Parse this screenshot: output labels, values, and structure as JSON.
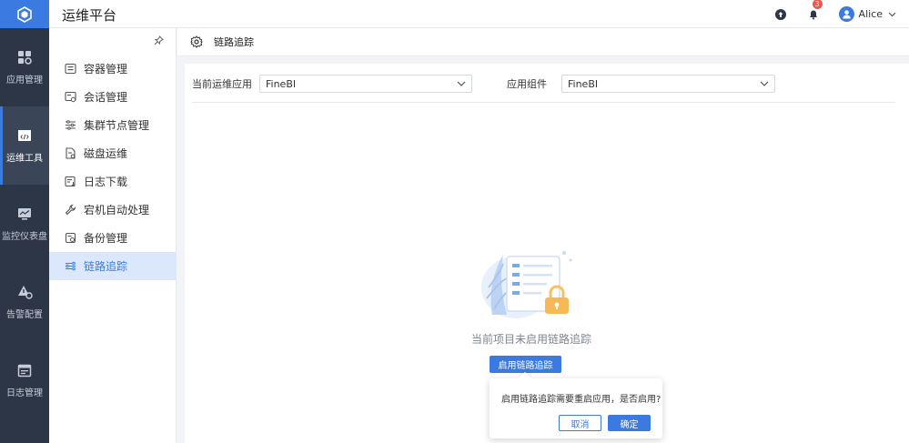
{
  "header": {
    "app_title": "运维平台",
    "notification_count": "3",
    "user_name": "Alice"
  },
  "leftnav": [
    {
      "label": "应用管理",
      "icon": "apps-grid-icon",
      "active": false
    },
    {
      "label": "运维工具",
      "icon": "code-window-icon",
      "active": true
    },
    {
      "label": "监控仪表盘",
      "icon": "monitor-icon",
      "active": false
    },
    {
      "label": "告警配置",
      "icon": "alert-settings-icon",
      "active": false
    },
    {
      "label": "日志管理",
      "icon": "calendar-log-icon",
      "active": false
    }
  ],
  "submenu": [
    {
      "label": "容器管理",
      "icon": "container-icon"
    },
    {
      "label": "会话管理",
      "icon": "session-icon"
    },
    {
      "label": "集群节点管理",
      "icon": "sliders-icon"
    },
    {
      "label": "磁盘运维",
      "icon": "disk-file-icon"
    },
    {
      "label": "日志下载",
      "icon": "log-download-icon"
    },
    {
      "label": "宕机自动处理",
      "icon": "wrench-icon"
    },
    {
      "label": "备份管理",
      "icon": "backup-icon"
    },
    {
      "label": "链路追踪",
      "icon": "trace-icon",
      "active": true
    }
  ],
  "page": {
    "title": "链路追踪"
  },
  "filters": {
    "app_label": "当前运维应用",
    "app_value": "FineBI",
    "component_label": "应用组件",
    "component_value": "FineBI"
  },
  "empty": {
    "message": "当前项目未启用链路追踪",
    "enable_button": "启用链路追踪"
  },
  "popconfirm": {
    "message": "启用链路追踪需要重启应用，是否启用?",
    "cancel": "取消",
    "confirm": "确定"
  },
  "colors": {
    "primary": "#3b7ae0",
    "nav_bg": "#2d3647",
    "badge": "#f0564b"
  }
}
